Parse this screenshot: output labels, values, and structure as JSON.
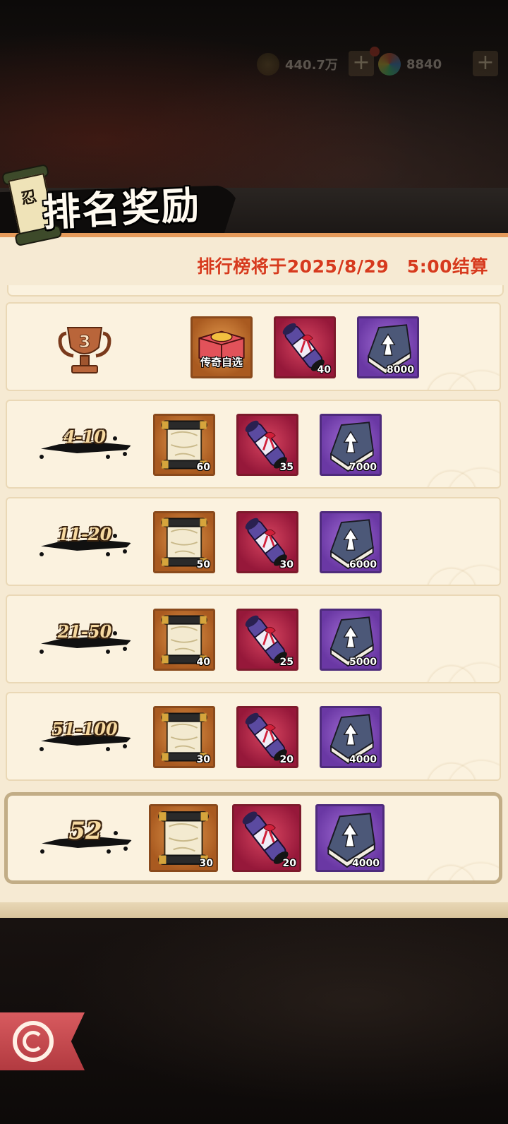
{
  "top_bar": {
    "coins": "440.7万",
    "gems": "8840",
    "plus_label": "+"
  },
  "panel": {
    "title": "排名奖励",
    "scroll_glyph": "忍",
    "settlement_text": "排行榜将于2025/8/29　5:00结算"
  },
  "rows": [
    {
      "rank": "3",
      "items": [
        {
          "type": "legendary-chest",
          "label": "传奇自选",
          "count": ""
        },
        {
          "type": "red-scroll",
          "count": "40"
        },
        {
          "type": "exp-book",
          "count": "8000"
        }
      ]
    },
    {
      "rank": "4-10",
      "items": [
        {
          "type": "orange-scroll",
          "count": "60"
        },
        {
          "type": "red-scroll",
          "count": "35"
        },
        {
          "type": "exp-book",
          "count": "7000"
        }
      ]
    },
    {
      "rank": "11-20",
      "items": [
        {
          "type": "orange-scroll",
          "count": "50"
        },
        {
          "type": "red-scroll",
          "count": "30"
        },
        {
          "type": "exp-book",
          "count": "6000"
        }
      ]
    },
    {
      "rank": "21-50",
      "items": [
        {
          "type": "orange-scroll",
          "count": "40"
        },
        {
          "type": "red-scroll",
          "count": "25"
        },
        {
          "type": "exp-book",
          "count": "5000"
        }
      ]
    },
    {
      "rank": "51-100",
      "items": [
        {
          "type": "orange-scroll",
          "count": "30"
        },
        {
          "type": "red-scroll",
          "count": "20"
        },
        {
          "type": "exp-book",
          "count": "4000"
        }
      ]
    }
  ],
  "my_row": {
    "rank": "52",
    "items": [
      {
        "type": "orange-scroll",
        "count": "30"
      },
      {
        "type": "red-scroll",
        "count": "20"
      },
      {
        "type": "exp-book",
        "count": "4000"
      }
    ]
  },
  "colors": {
    "panel_bg": "#f6ead3",
    "settlement_red": "#d63a1e",
    "rare_orange": "#d98a3f",
    "rare_red": "#c2304a",
    "rare_purple": "#8a55c4"
  },
  "icons": {
    "back": "swirl-back-icon"
  }
}
